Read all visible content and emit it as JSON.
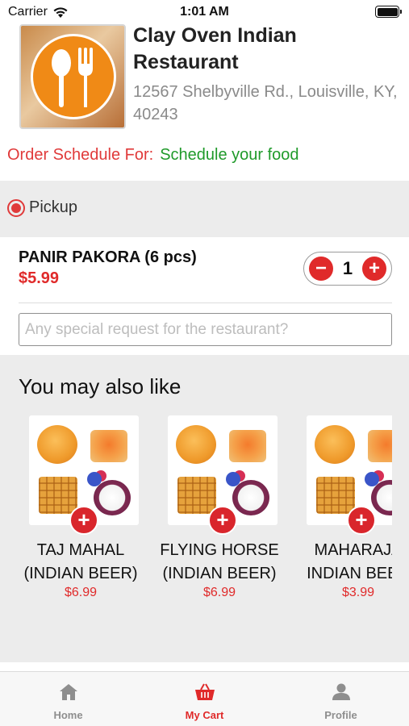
{
  "status_bar": {
    "carrier": "Carrier",
    "time": "1:01 AM"
  },
  "restaurant": {
    "name": "Clay Oven Indian Restaurant",
    "address": "12567 Shelbyville Rd., Louisville, KY, 40243"
  },
  "schedule": {
    "label": "Order Schedule For:",
    "value": "Schedule your food"
  },
  "order_type": {
    "label": "Pickup",
    "selected": true
  },
  "cart_item": {
    "name": "PANIR PAKORA (6 pcs)",
    "price": "$5.99",
    "quantity": "1",
    "request_placeholder": "Any special request for the restaurant?"
  },
  "suggestions": {
    "title": "You may also like",
    "items": [
      {
        "name": "TAJ MAHAL\n(INDIAN BEER)",
        "price": "$6.99"
      },
      {
        "name": "FLYING HORSE\n(INDIAN BEER)",
        "price": "$6.99"
      },
      {
        "name": "MAHARAJA\n(INDIAN BEER)",
        "price": "$3.99"
      }
    ]
  },
  "tab_bar": {
    "items": [
      {
        "label": "Home",
        "icon": "home-icon"
      },
      {
        "label": "My Cart",
        "icon": "basket-icon"
      },
      {
        "label": "Profile",
        "icon": "person-icon"
      }
    ],
    "active": "My Cart"
  },
  "colors": {
    "accent": "#e02a2a",
    "schedule_value": "#1f9a2a",
    "logo": "#f08a16"
  }
}
